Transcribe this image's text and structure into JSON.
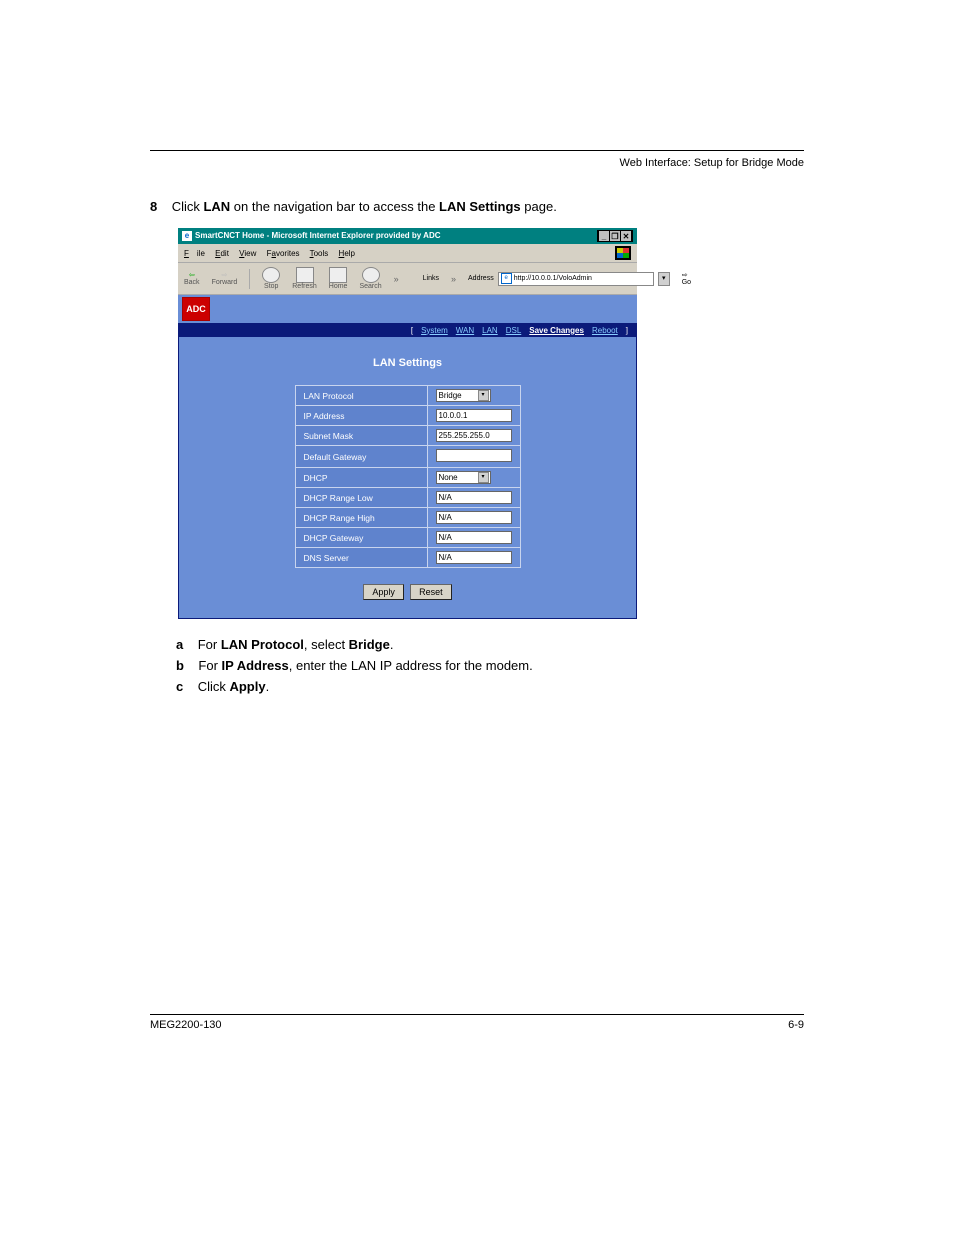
{
  "header": {
    "title": "Web Interface: Setup for Bridge Mode"
  },
  "step_intro": {
    "num": "8",
    "prefix": "Click ",
    "link": "LAN",
    "mid": " on the navigation bar to access the ",
    "bold": "LAN Settings",
    "suffix": " page."
  },
  "window": {
    "title": "SmartCNCT Home - Microsoft Internet Explorer provided by ADC",
    "controls": {
      "min": "_",
      "max": "❐",
      "close": "✕"
    },
    "menu": {
      "file": "File",
      "edit": "Edit",
      "view": "View",
      "favorites": "Favorites",
      "tools": "Tools",
      "help": "Help"
    },
    "toolbar": {
      "back": "Back",
      "forward": "Forward",
      "stop": "Stop",
      "refresh": "Refresh",
      "home": "Home",
      "search": "Search",
      "links_label": "Links",
      "address_label": "Address",
      "address_value": "http://10.0.0.1/VoloAdmin",
      "go": "Go"
    },
    "logo_text": "ADC",
    "nav": {
      "open_bracket": "[",
      "close_bracket": "]",
      "system": "System",
      "wan": "WAN",
      "lan": "LAN",
      "dsl": "DSL",
      "save": "Save Changes",
      "reboot": "Reboot"
    },
    "panel_title": "LAN Settings",
    "fields": {
      "lan_protocol": {
        "label": "LAN Protocol",
        "value": "Bridge"
      },
      "ip_address": {
        "label": "IP Address",
        "value": "10.0.0.1"
      },
      "subnet_mask": {
        "label": "Subnet Mask",
        "value": "255.255.255.0"
      },
      "default_gw": {
        "label": "Default Gateway",
        "value": ""
      },
      "dhcp": {
        "label": "DHCP",
        "value": "None"
      },
      "dhcp_low": {
        "label": "DHCP Range Low",
        "value": "N/A"
      },
      "dhcp_high": {
        "label": "DHCP Range High",
        "value": "N/A"
      },
      "dhcp_gw": {
        "label": "DHCP Gateway",
        "value": "N/A"
      },
      "dns": {
        "label": "DNS Server",
        "value": "N/A"
      }
    },
    "buttons": {
      "apply": "Apply",
      "reset": "Reset"
    }
  },
  "post_steps": {
    "s1": {
      "bul": "a",
      "p1": "For ",
      "b1": "LAN Protocol",
      "p2": ", select ",
      "b2": "Bridge",
      "p3": "."
    },
    "s2": {
      "bul": "b",
      "p1": "For ",
      "b1": "IP Address",
      "p2": ", enter the LAN IP address for the modem."
    },
    "s3": {
      "bul": "c",
      "p1": "Click ",
      "b1": "Apply",
      "p2": "."
    }
  },
  "footer": {
    "left": "MEG2200-130",
    "right": "6-9"
  }
}
